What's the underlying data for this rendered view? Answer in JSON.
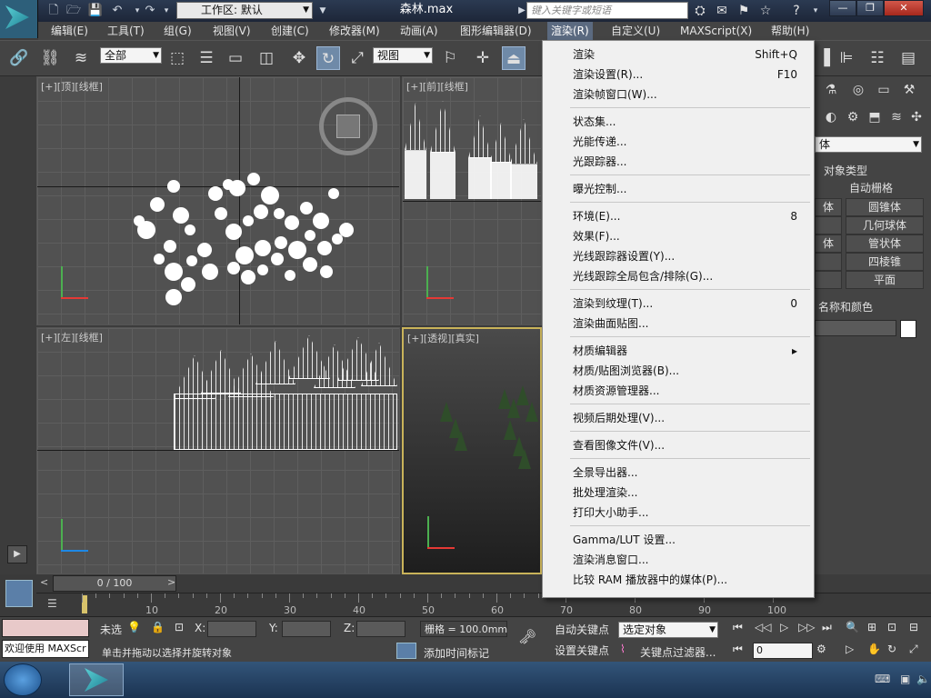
{
  "title_bar": {
    "file_title": "森林.max",
    "workspace_label": "工作区: 默认",
    "search_placeholder": "键入关键字或短语"
  },
  "menubar": {
    "items": [
      "编辑(E)",
      "工具(T)",
      "组(G)",
      "视图(V)",
      "创建(C)",
      "修改器(M)",
      "动画(A)",
      "图形编辑器(D)",
      "渲染(R)",
      "自定义(U)",
      "MAXScript(X)",
      "帮助(H)"
    ],
    "active_index": 8
  },
  "main_toolbar": {
    "selection_filter": "全部",
    "reference_coord": "视图"
  },
  "viewports": {
    "top": "[+][顶][线框]",
    "front": "[+][前][线框]",
    "left": "[+][左][线框]",
    "perspective": "[+][透视][真实]"
  },
  "render_menu": {
    "items": [
      {
        "label": "渲染",
        "shortcut": "Shift+Q"
      },
      {
        "label": "渲染设置(R)...",
        "shortcut": "F10"
      },
      {
        "label": "渲染帧窗口(W)...",
        "shortcut": ""
      },
      {
        "label": "状态集...",
        "shortcut": ""
      },
      {
        "label": "光能传递...",
        "shortcut": ""
      },
      {
        "label": "光跟踪器...",
        "shortcut": ""
      },
      {
        "label": "曝光控制...",
        "shortcut": ""
      },
      {
        "label": "环境(E)...",
        "shortcut": "8"
      },
      {
        "label": "效果(F)...",
        "shortcut": ""
      },
      {
        "label": "光线跟踪器设置(Y)...",
        "shortcut": ""
      },
      {
        "label": "光线跟踪全局包含/排除(G)...",
        "shortcut": ""
      },
      {
        "label": "渲染到纹理(T)...",
        "shortcut": "0"
      },
      {
        "label": "渲染曲面贴图...",
        "shortcut": ""
      },
      {
        "label": "材质编辑器",
        "shortcut": "▸"
      },
      {
        "label": "材质/贴图浏览器(B)...",
        "shortcut": ""
      },
      {
        "label": "材质资源管理器...",
        "shortcut": ""
      },
      {
        "label": "视频后期处理(V)...",
        "shortcut": ""
      },
      {
        "label": "查看图像文件(V)...",
        "shortcut": ""
      },
      {
        "label": "全景导出器...",
        "shortcut": ""
      },
      {
        "label": "批处理渲染...",
        "shortcut": ""
      },
      {
        "label": "打印大小助手...",
        "shortcut": ""
      },
      {
        "label": "Gamma/LUT 设置...",
        "shortcut": ""
      },
      {
        "label": "渲染消息窗口...",
        "shortcut": ""
      },
      {
        "label": "比较 RAM 播放器中的媒体(P)...",
        "shortcut": ""
      }
    ]
  },
  "command_panel": {
    "category": "体",
    "rollout_object_type": "对象类型",
    "auto_grid": "自动栅格",
    "buttons": [
      "体",
      "圆锥体",
      "",
      "几何球体",
      "体",
      "管状体",
      "",
      "四棱锥",
      "",
      "平面"
    ],
    "rollout_name_color": "名称和颜色"
  },
  "timeline": {
    "frame_counter": "0 / 100",
    "ticks": [
      "10",
      "20",
      "30",
      "40",
      "50",
      "60",
      "70",
      "80",
      "90",
      "100"
    ]
  },
  "status_bar": {
    "listener_text": "欢迎使用 MAXScr",
    "selection_status": "未选",
    "x_label": "X:",
    "y_label": "Y:",
    "z_label": "Z:",
    "grid_label": "栅格 = 100.0mm",
    "prompt": "单击并拖动以选择并旋转对象",
    "add_time_tag": "添加时间标记",
    "auto_key": "自动关键点",
    "set_key": "设置关键点",
    "key_filter_dd": "选定对象",
    "key_filters": "关键点过滤器...",
    "frame_value": "0"
  },
  "colors": {
    "accent": "#5b6a80",
    "viewport_border_active": "#c9b35a"
  }
}
